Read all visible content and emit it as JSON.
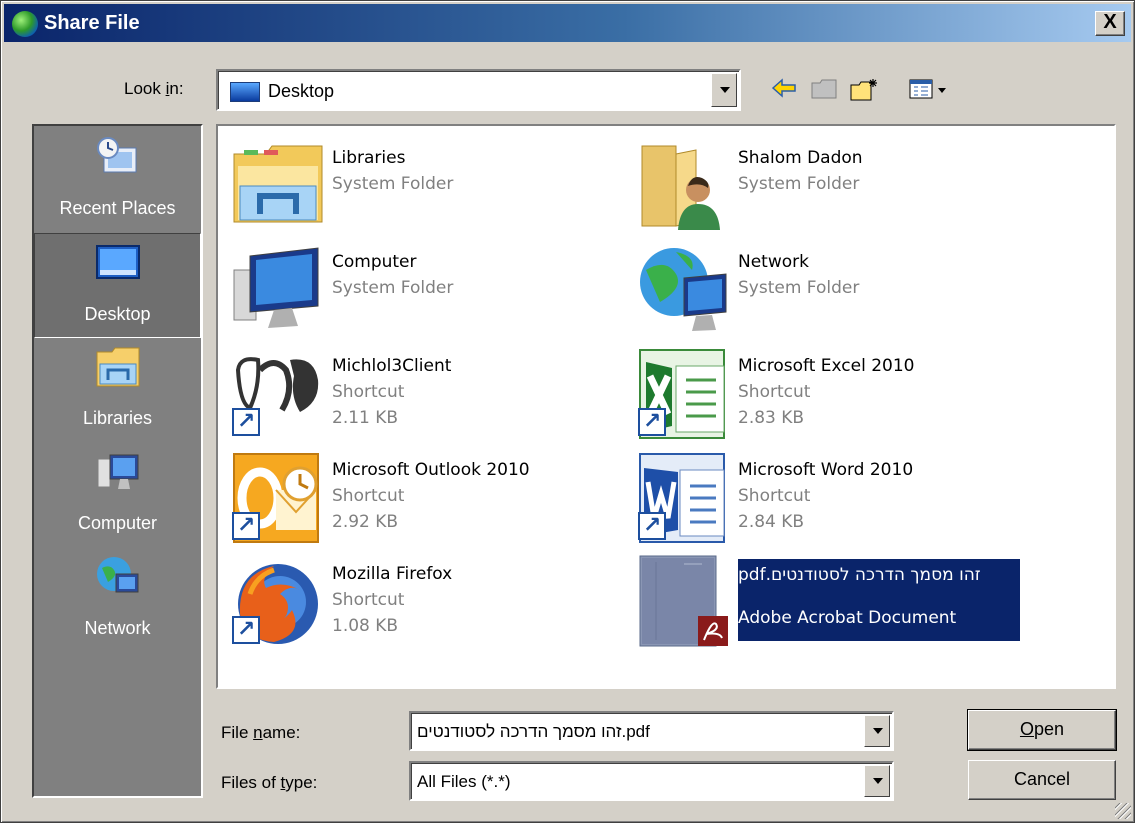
{
  "window": {
    "title": "Share File",
    "close": "X"
  },
  "lookin": {
    "label_pre": "Look ",
    "label_u": "i",
    "label_post": "n:",
    "value": "Desktop"
  },
  "places": [
    {
      "label": "Recent Places",
      "icon": "recent-places-icon"
    },
    {
      "label": "Desktop",
      "icon": "desktop-icon",
      "selected": true
    },
    {
      "label": "Libraries",
      "icon": "libraries-icon"
    },
    {
      "label": "Computer",
      "icon": "computer-icon"
    },
    {
      "label": "Network",
      "icon": "network-icon"
    }
  ],
  "files": [
    {
      "name": "Libraries",
      "type": "System Folder"
    },
    {
      "name": "Shalom Dadon",
      "type": "System Folder"
    },
    {
      "name": "Computer",
      "type": "System Folder"
    },
    {
      "name": "Network",
      "type": "System Folder"
    },
    {
      "name": "Michlol3Client",
      "type": "Shortcut",
      "size": "2.11 KB"
    },
    {
      "name": "Microsoft Excel 2010",
      "type": "Shortcut",
      "size": "2.83 KB"
    },
    {
      "name": "Microsoft Outlook 2010",
      "type": "Shortcut",
      "size": "2.92 KB"
    },
    {
      "name": "Microsoft Word 2010",
      "type": "Shortcut",
      "size": "2.84 KB"
    },
    {
      "name": "Mozilla Firefox",
      "type": "Shortcut",
      "size": "1.08 KB"
    },
    {
      "name": "זהו מסמך הדרכה לסטודנטים.pdf",
      "type": "Adobe Acrobat Document"
    }
  ],
  "filename": {
    "label_pre": "File ",
    "label_u": "n",
    "label_post": "ame:",
    "value": "זהו מסמך הדרכה לסטודנטים.pdf"
  },
  "filetype": {
    "label_pre": "Files of ",
    "label_u": "t",
    "label_post": "ype:",
    "value": "All Files (*.*)"
  },
  "buttons": {
    "open_u": "O",
    "open_rest": "pen",
    "cancel": "Cancel"
  },
  "colors": {
    "titlebar": "#0a246a",
    "selection": "#0a246a",
    "face": "#d4d0c8"
  }
}
